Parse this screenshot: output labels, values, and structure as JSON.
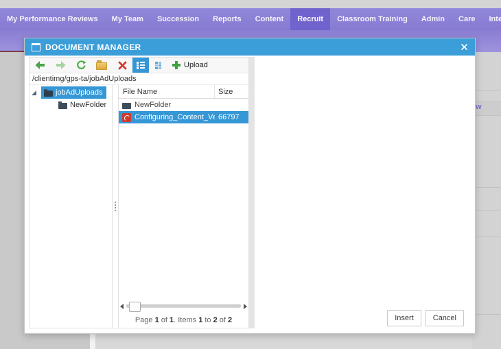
{
  "nav": {
    "tabs": [
      {
        "label": "My Performance Reviews",
        "selected": false
      },
      {
        "label": "My Team",
        "selected": false
      },
      {
        "label": "Succession",
        "selected": false
      },
      {
        "label": "Reports",
        "selected": false
      },
      {
        "label": "Content",
        "selected": false
      },
      {
        "label": "Recruit",
        "selected": true
      },
      {
        "label": "Classroom Training",
        "selected": false
      },
      {
        "label": "Admin",
        "selected": false
      },
      {
        "label": "Care",
        "selected": false
      },
      {
        "label": "Inte",
        "selected": false,
        "truncated": true
      }
    ]
  },
  "background": {
    "partial_link_text": "w"
  },
  "dialog": {
    "title": "DOCUMENT MANAGER",
    "path": "/clientimg/gps-ta/jobAdUploads",
    "toolbar": {
      "upload_label": "Upload",
      "icons": [
        "back-arrow-icon",
        "forward-arrow-icon",
        "refresh-icon",
        "new-folder-icon",
        "delete-icon",
        "list-view-icon",
        "grid-view-icon",
        "upload-plus-icon"
      ]
    },
    "tree": {
      "root": "jobAdUploads",
      "children": [
        "NewFolder"
      ]
    },
    "list": {
      "columns": [
        "File Name",
        "Size"
      ],
      "rows": [
        {
          "name": "NewFolder",
          "type": "folder",
          "size": "",
          "selected": false
        },
        {
          "name": "Configuring_Content_Vendo",
          "type": "pdf",
          "size": "66797",
          "selected": true
        }
      ],
      "pagination_segments": [
        "Page ",
        "1",
        " of ",
        "1",
        ". Items ",
        "1",
        " to ",
        "2",
        " of ",
        "2"
      ]
    },
    "footer": {
      "insert_label": "Insert",
      "cancel_label": "Cancel"
    },
    "colors": {
      "titlebar": "#3b9ed8",
      "selection": "#3697d6",
      "nav_purple": "#867ad2",
      "nav_selected": "#7163cd"
    }
  }
}
